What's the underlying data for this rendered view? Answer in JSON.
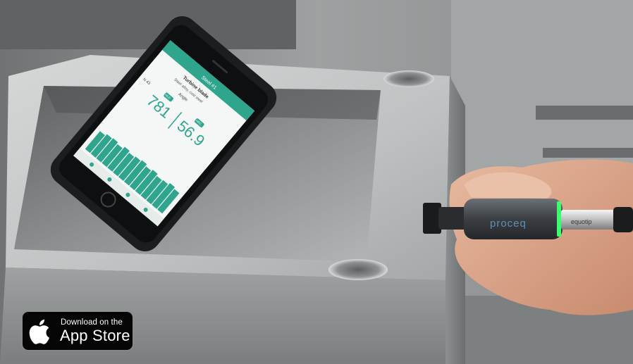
{
  "badge": {
    "line1": "Download on the",
    "line2": "App Store",
    "icon": "apple-logo-icon"
  },
  "phone": {
    "header_label": "Steel #1",
    "title": "Turbine blade",
    "subtitle": "Steel alloy, cast steel",
    "scale_left": "HLD",
    "reading_left": "781",
    "reading_right": "56.9",
    "scale_right": "HRC",
    "small_left": "N 43",
    "small_top": "Angle",
    "bars": [
      0.55,
      0.6,
      0.62,
      0.58,
      0.64,
      0.6,
      0.63,
      0.66,
      0.61,
      0.65,
      0.6,
      0.62,
      0.67,
      0.63
    ]
  },
  "probe": {
    "brand": "proceq",
    "model": "equotip",
    "led_color": "#39ff6a"
  },
  "colors": {
    "app_accent": "#2fa58e",
    "steel": "#a9acad",
    "background": "#8e9293"
  }
}
